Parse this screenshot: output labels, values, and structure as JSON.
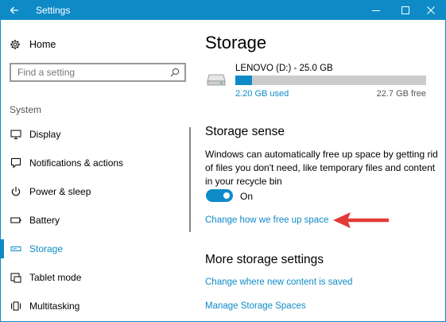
{
  "window": {
    "title": "Settings",
    "accent": "#0e8bc7"
  },
  "sidebar": {
    "home": {
      "label": "Home",
      "icon": "gear-icon"
    },
    "search": {
      "placeholder": "Find a setting",
      "icon": "search-icon"
    },
    "group_label": "System",
    "items": [
      {
        "label": "Display",
        "icon": "monitor-icon"
      },
      {
        "label": "Notifications & actions",
        "icon": "notification-icon"
      },
      {
        "label": "Power & sleep",
        "icon": "power-icon"
      },
      {
        "label": "Battery",
        "icon": "battery-icon"
      },
      {
        "label": "Storage",
        "icon": "storage-icon",
        "active": true
      },
      {
        "label": "Tablet mode",
        "icon": "tablet-mode-icon"
      },
      {
        "label": "Multitasking",
        "icon": "multitasking-icon"
      }
    ]
  },
  "main": {
    "title": "Storage",
    "drive": {
      "label": "LENOVO (D:) - 25.0 GB",
      "used": "2.20 GB used",
      "free": "22.7 GB free",
      "used_fraction": 0.088,
      "icon": "hard-drive-icon"
    },
    "storage_sense": {
      "heading": "Storage sense",
      "description": "Windows can automatically free up space by getting rid of files you don't need, like temporary files and content in your recycle bin",
      "toggle_state": "On",
      "link": "Change how we free up space"
    },
    "more": {
      "heading": "More storage settings",
      "links": [
        "Change where new content is saved",
        "Manage Storage Spaces"
      ]
    },
    "annotation_arrow_color": "#e53935"
  }
}
